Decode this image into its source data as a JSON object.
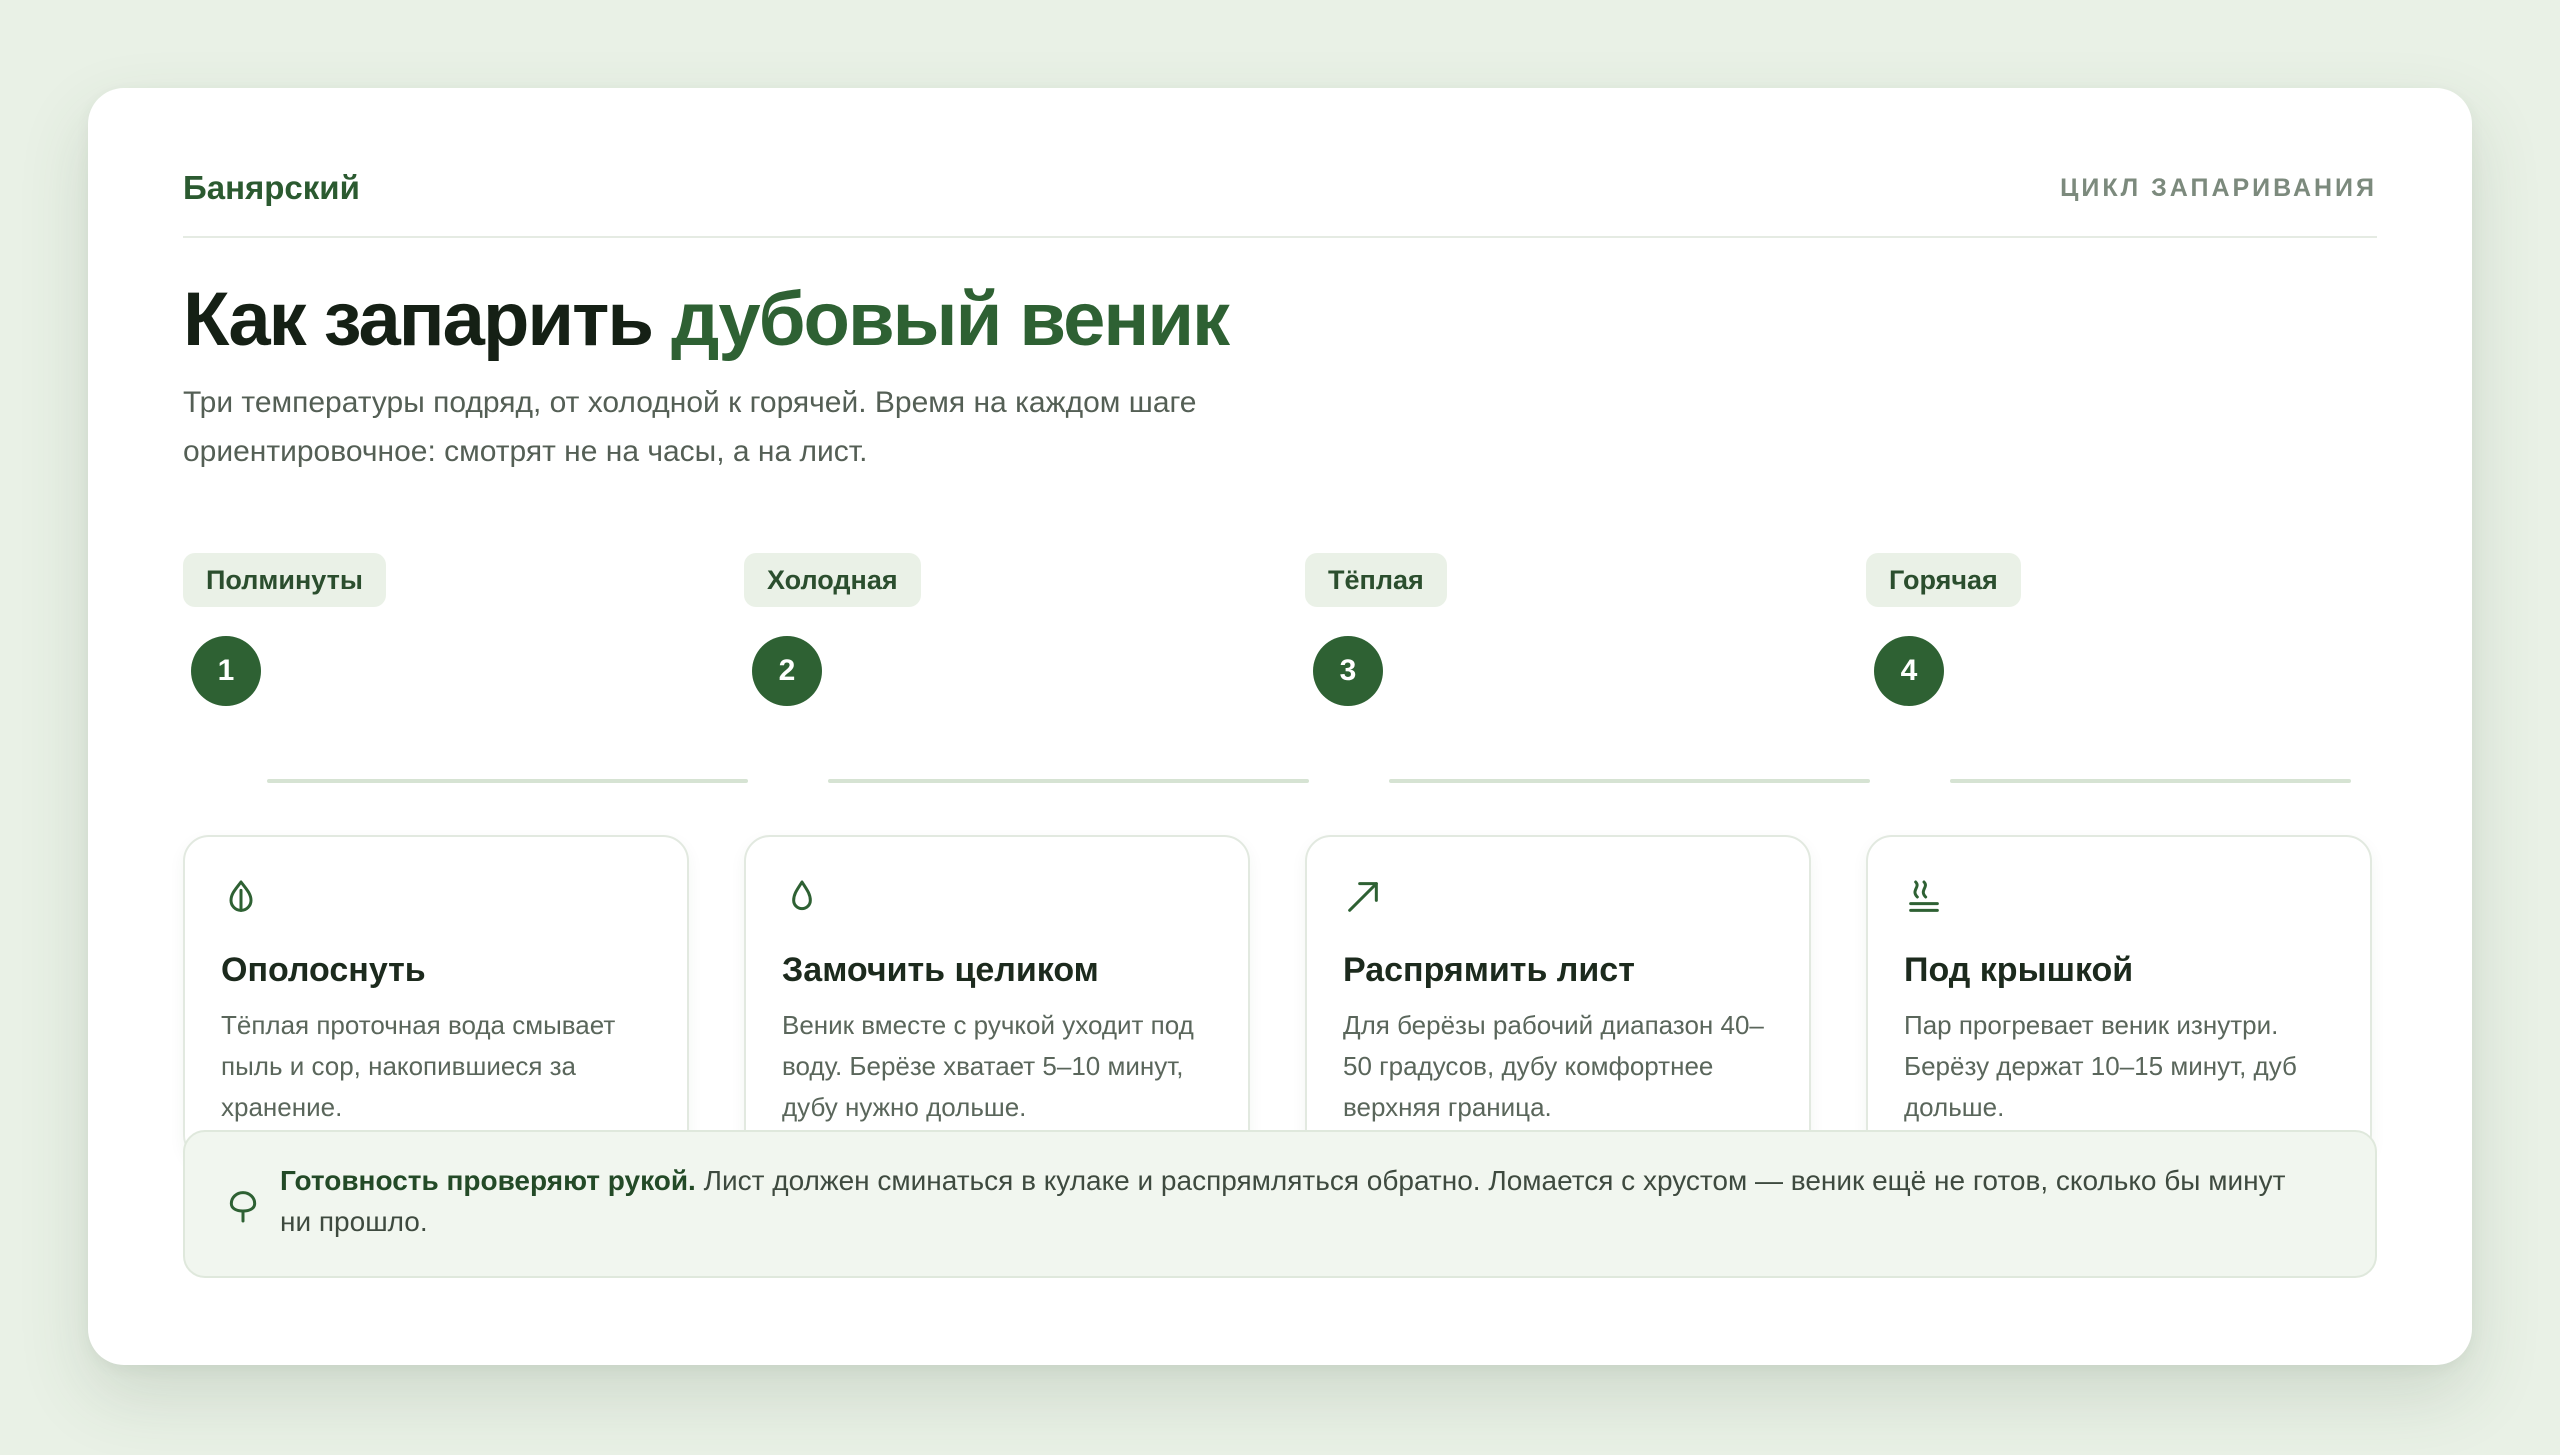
{
  "header": {
    "brand": "Банярский",
    "section_label": "ЦИКЛ ЗАПАРИВАНИЯ"
  },
  "hero": {
    "title_plain": "Как запарить ",
    "title_accent": "дубовый веник",
    "subtitle": "Три температуры подряд, от холодной к горячей. Время на каждом шаге ориентировочное: смотрят не на часы, а на лист."
  },
  "steps": [
    {
      "number": "1",
      "chip": "Полминуты",
      "icon": "leaf-drop-icon",
      "title": "Ополоснуть",
      "text": "Тёплая проточная вода смывает пыль и сор, накопившиеся за хранение."
    },
    {
      "number": "2",
      "chip": "Холодная",
      "icon": "water-drop-icon",
      "title": "Замочить целиком",
      "text": "Веник вместе с ручкой уходит под воду. Берёзе хватает 5–10 минут, дубу нужно дольше."
    },
    {
      "number": "3",
      "chip": "Тёплая",
      "icon": "arrow-up-right-icon",
      "title": "Распрямить лист",
      "text": "Для берёзы рабочий диапазон 40–50 градусов, дубу комфортнее верхняя граница."
    },
    {
      "number": "4",
      "chip": "Горячая",
      "icon": "steam-icon",
      "title": "Под крышкой",
      "text": "Пар прогревает веник изнутри. Берёзу держат 10–15 минут, дуб дольше."
    }
  ],
  "note": {
    "icon": "tree-icon",
    "lead": "Готовность проверяют рукой.",
    "text": " Лист должен сминаться в кулаке и распрямляться обратно. Ломается с хрустом — веник ещё не готов, сколько бы минут ни прошло."
  },
  "colors": {
    "accent": "#2e6133",
    "background": "#e9f1e6",
    "chip_bg": "#eaf1e7",
    "connector": "#d6e3d3"
  }
}
